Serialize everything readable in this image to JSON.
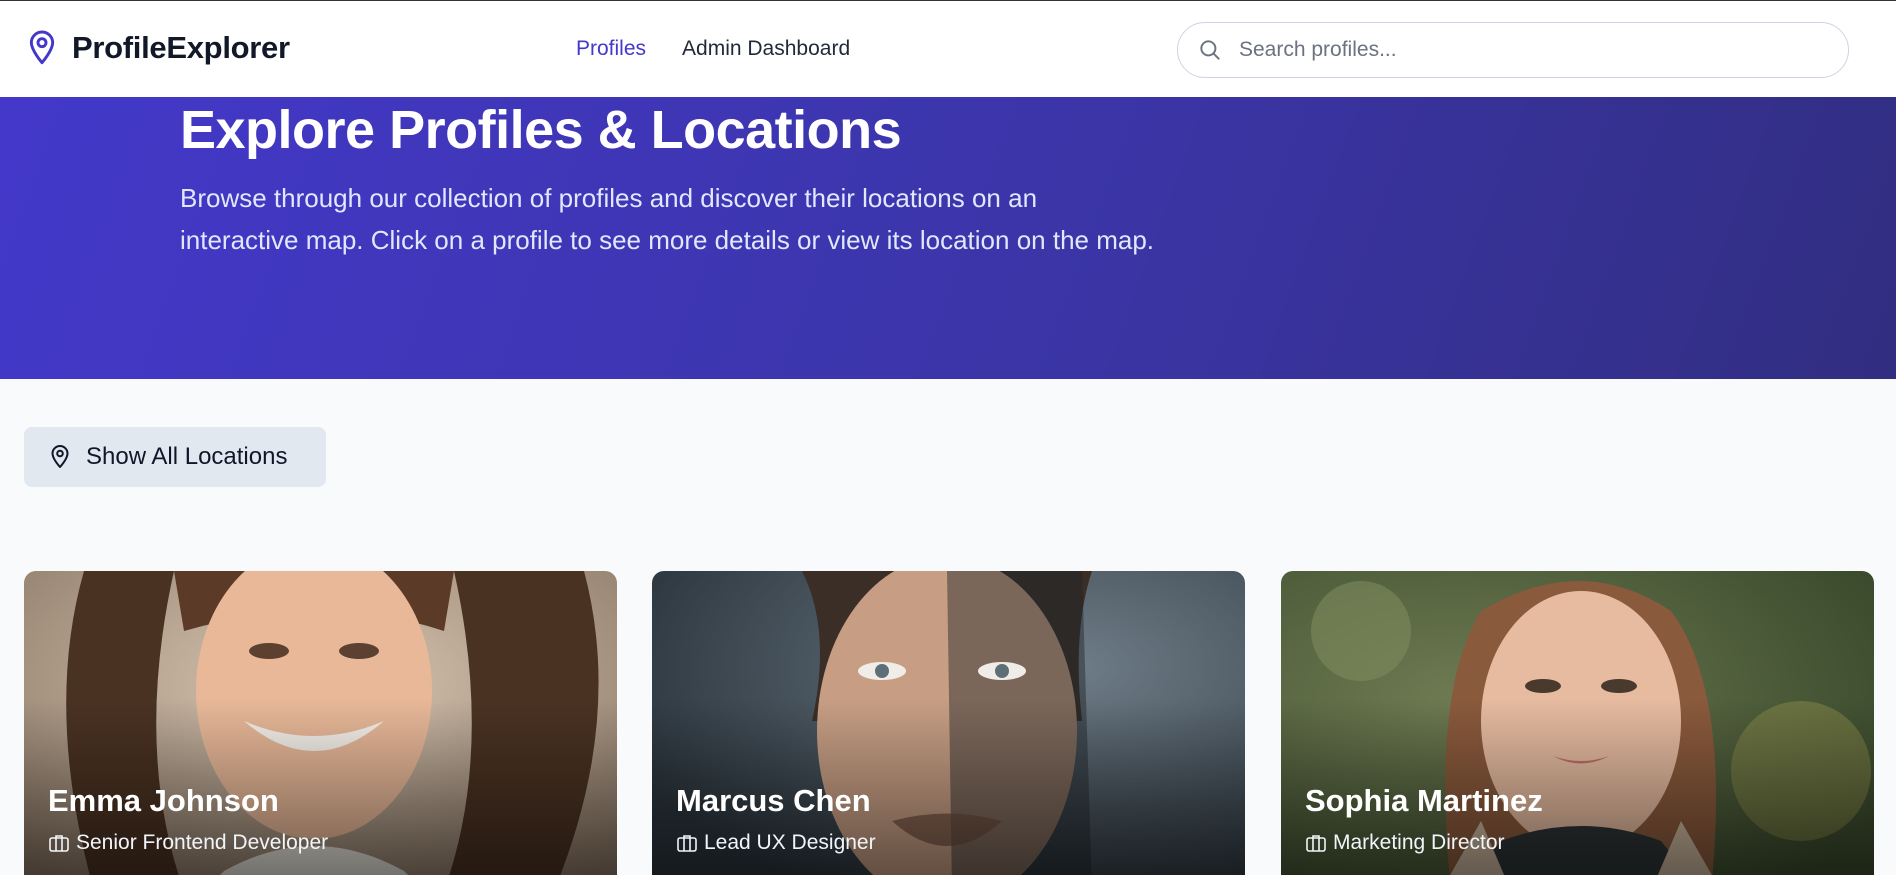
{
  "header": {
    "brand_name": "ProfileExplorer",
    "brand_icon": "map-pin-icon",
    "nav": [
      {
        "label": "Profiles",
        "active": true
      },
      {
        "label": "Admin Dashboard",
        "active": false
      }
    ],
    "search": {
      "placeholder": "Search profiles...",
      "value": "",
      "icon": "search-icon"
    }
  },
  "hero": {
    "title": "Explore Profiles & Locations",
    "description": "Browse through our collection of profiles and discover their locations on an interactive map. Click on a profile to see more details or view its location on the map."
  },
  "actions": {
    "show_all_label": "Show All Locations",
    "show_all_icon": "map-pin-icon"
  },
  "profiles": [
    {
      "name": "Emma Johnson",
      "role": "Senior Frontend Developer",
      "role_icon": "briefcase-icon"
    },
    {
      "name": "Marcus Chen",
      "role": "Lead UX Designer",
      "role_icon": "briefcase-icon"
    },
    {
      "name": "Sophia Martinez",
      "role": "Marketing Director",
      "role_icon": "briefcase-icon"
    }
  ],
  "colors": {
    "accent": "#4338ca",
    "hero_start": "#4338ca",
    "hero_end": "#312e81",
    "page_bg": "#f8fafc",
    "button_bg": "#e2e8f0"
  }
}
